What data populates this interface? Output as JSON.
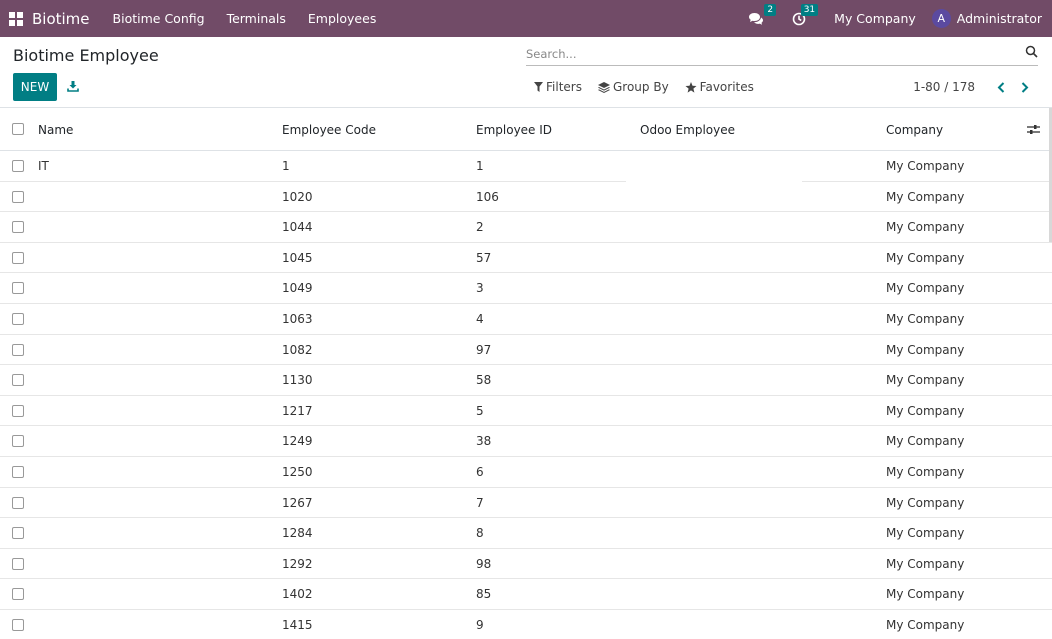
{
  "navbar": {
    "app_name": "Biotime",
    "menu": [
      "Biotime Config",
      "Terminals",
      "Employees"
    ],
    "messages_count": "2",
    "activities_count": "31",
    "company": "My Company",
    "user_initial": "A",
    "user_name": "Administrator"
  },
  "control_panel": {
    "title": "Biotime Employee",
    "new_label": "NEW",
    "search_placeholder": "Search...",
    "filters_label": "Filters",
    "group_by_label": "Group By",
    "favorites_label": "Favorites",
    "pager_value": "1-80 / 178"
  },
  "table": {
    "columns": [
      "Name",
      "Employee Code",
      "Employee ID",
      "Odoo Employee",
      "Company"
    ],
    "rows": [
      {
        "name": "IT",
        "code": "1",
        "id": "1",
        "odoo_employee": "",
        "company": "My Company"
      },
      {
        "name": "",
        "code": "1020",
        "id": "106",
        "odoo_employee": "",
        "company": "My Company"
      },
      {
        "name": "",
        "code": "1044",
        "id": "2",
        "odoo_employee": "",
        "company": "My Company"
      },
      {
        "name": "",
        "code": "1045",
        "id": "57",
        "odoo_employee": "",
        "company": "My Company"
      },
      {
        "name": "",
        "code": "1049",
        "id": "3",
        "odoo_employee": "",
        "company": "My Company"
      },
      {
        "name": "",
        "code": "1063",
        "id": "4",
        "odoo_employee": "",
        "company": "My Company"
      },
      {
        "name": "",
        "code": "1082",
        "id": "97",
        "odoo_employee": "",
        "company": "My Company"
      },
      {
        "name": "",
        "code": "1130",
        "id": "58",
        "odoo_employee": "",
        "company": "My Company"
      },
      {
        "name": "",
        "code": "1217",
        "id": "5",
        "odoo_employee": "",
        "company": "My Company"
      },
      {
        "name": "",
        "code": "1249",
        "id": "38",
        "odoo_employee": "",
        "company": "My Company"
      },
      {
        "name": "",
        "code": "1250",
        "id": "6",
        "odoo_employee": "",
        "company": "My Company"
      },
      {
        "name": "",
        "code": "1267",
        "id": "7",
        "odoo_employee": "",
        "company": "My Company"
      },
      {
        "name": "",
        "code": "1284",
        "id": "8",
        "odoo_employee": "",
        "company": "My Company"
      },
      {
        "name": "",
        "code": "1292",
        "id": "98",
        "odoo_employee": "",
        "company": "My Company"
      },
      {
        "name": "",
        "code": "1402",
        "id": "85",
        "odoo_employee": "",
        "company": "My Company"
      },
      {
        "name": "",
        "code": "1415",
        "id": "9",
        "odoo_employee": "",
        "company": "My Company"
      }
    ]
  },
  "colors": {
    "navbar": "#714b67",
    "primary_button": "#017e84",
    "badge": "#017e84"
  },
  "icons": {
    "apps": "apps-grid-icon",
    "messages": "chat-bubbles-icon",
    "activities": "clock-icon",
    "download": "download-icon",
    "search": "search-icon",
    "filter": "filter-funnel-icon",
    "group_by": "layers-icon",
    "favorites": "star-icon",
    "pager_prev": "chevron-left-icon",
    "pager_next": "chevron-right-icon",
    "optional_columns": "sliders-icon"
  }
}
